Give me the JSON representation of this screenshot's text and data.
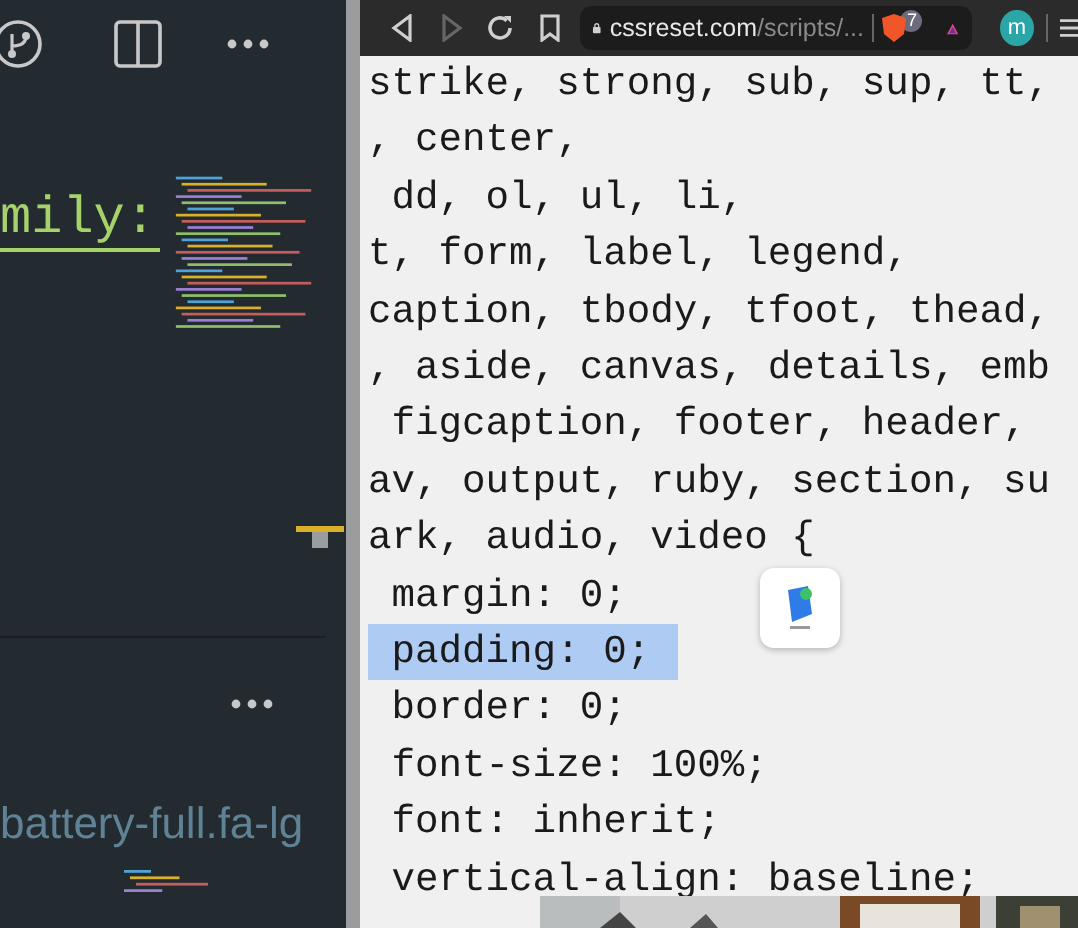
{
  "editor": {
    "heading_fragment": "mily:",
    "selector_fragment": "battery-full.fa-lg"
  },
  "browser": {
    "back_disabled": false,
    "forward_disabled": true,
    "url_host": "cssreset.com",
    "url_path": "/scripts/...",
    "extension_badge": "7",
    "profile_initial": "m",
    "code_lines": [
      {
        "text": "strike, strong, sub, sup, tt,",
        "selected": false
      },
      {
        "text": ", center,",
        "selected": false
      },
      {
        "text": " dd, ol, ul, li,",
        "selected": false
      },
      {
        "text": "t, form, label, legend,",
        "selected": false
      },
      {
        "text": "caption, tbody, tfoot, thead,",
        "selected": false
      },
      {
        "text": ", aside, canvas, details, emb",
        "selected": false
      },
      {
        "text": " figcaption, footer, header,",
        "selected": false
      },
      {
        "text": "av, output, ruby, section, su",
        "selected": false
      },
      {
        "text": "ark, audio, video {",
        "selected": false
      },
      {
        "text": " margin: 0;",
        "selected": false
      },
      {
        "text": " padding: 0;",
        "selected": true
      },
      {
        "text": " border: 0;",
        "selected": false
      },
      {
        "text": " font-size: 100%;",
        "selected": false
      },
      {
        "text": " font: inherit;",
        "selected": false
      },
      {
        "text": " vertical-align: baseline;",
        "selected": false
      }
    ]
  }
}
